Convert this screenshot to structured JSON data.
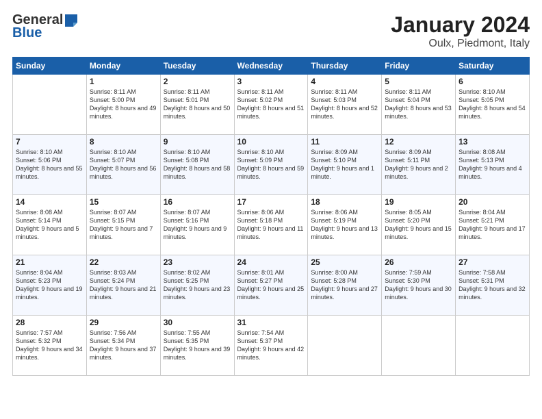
{
  "logo": {
    "general": "General",
    "blue": "Blue"
  },
  "title": "January 2024",
  "subtitle": "Oulx, Piedmont, Italy",
  "days_of_week": [
    "Sunday",
    "Monday",
    "Tuesday",
    "Wednesday",
    "Thursday",
    "Friday",
    "Saturday"
  ],
  "weeks": [
    [
      {
        "day": "",
        "sunrise": "",
        "sunset": "",
        "daylight": "",
        "empty": true
      },
      {
        "day": "1",
        "sunrise": "Sunrise: 8:11 AM",
        "sunset": "Sunset: 5:00 PM",
        "daylight": "Daylight: 8 hours and 49 minutes."
      },
      {
        "day": "2",
        "sunrise": "Sunrise: 8:11 AM",
        "sunset": "Sunset: 5:01 PM",
        "daylight": "Daylight: 8 hours and 50 minutes."
      },
      {
        "day": "3",
        "sunrise": "Sunrise: 8:11 AM",
        "sunset": "Sunset: 5:02 PM",
        "daylight": "Daylight: 8 hours and 51 minutes."
      },
      {
        "day": "4",
        "sunrise": "Sunrise: 8:11 AM",
        "sunset": "Sunset: 5:03 PM",
        "daylight": "Daylight: 8 hours and 52 minutes."
      },
      {
        "day": "5",
        "sunrise": "Sunrise: 8:11 AM",
        "sunset": "Sunset: 5:04 PM",
        "daylight": "Daylight: 8 hours and 53 minutes."
      },
      {
        "day": "6",
        "sunrise": "Sunrise: 8:10 AM",
        "sunset": "Sunset: 5:05 PM",
        "daylight": "Daylight: 8 hours and 54 minutes."
      }
    ],
    [
      {
        "day": "7",
        "sunrise": "Sunrise: 8:10 AM",
        "sunset": "Sunset: 5:06 PM",
        "daylight": "Daylight: 8 hours and 55 minutes."
      },
      {
        "day": "8",
        "sunrise": "Sunrise: 8:10 AM",
        "sunset": "Sunset: 5:07 PM",
        "daylight": "Daylight: 8 hours and 56 minutes."
      },
      {
        "day": "9",
        "sunrise": "Sunrise: 8:10 AM",
        "sunset": "Sunset: 5:08 PM",
        "daylight": "Daylight: 8 hours and 58 minutes."
      },
      {
        "day": "10",
        "sunrise": "Sunrise: 8:10 AM",
        "sunset": "Sunset: 5:09 PM",
        "daylight": "Daylight: 8 hours and 59 minutes."
      },
      {
        "day": "11",
        "sunrise": "Sunrise: 8:09 AM",
        "sunset": "Sunset: 5:10 PM",
        "daylight": "Daylight: 9 hours and 1 minute."
      },
      {
        "day": "12",
        "sunrise": "Sunrise: 8:09 AM",
        "sunset": "Sunset: 5:11 PM",
        "daylight": "Daylight: 9 hours and 2 minutes."
      },
      {
        "day": "13",
        "sunrise": "Sunrise: 8:08 AM",
        "sunset": "Sunset: 5:13 PM",
        "daylight": "Daylight: 9 hours and 4 minutes."
      }
    ],
    [
      {
        "day": "14",
        "sunrise": "Sunrise: 8:08 AM",
        "sunset": "Sunset: 5:14 PM",
        "daylight": "Daylight: 9 hours and 5 minutes."
      },
      {
        "day": "15",
        "sunrise": "Sunrise: 8:07 AM",
        "sunset": "Sunset: 5:15 PM",
        "daylight": "Daylight: 9 hours and 7 minutes."
      },
      {
        "day": "16",
        "sunrise": "Sunrise: 8:07 AM",
        "sunset": "Sunset: 5:16 PM",
        "daylight": "Daylight: 9 hours and 9 minutes."
      },
      {
        "day": "17",
        "sunrise": "Sunrise: 8:06 AM",
        "sunset": "Sunset: 5:18 PM",
        "daylight": "Daylight: 9 hours and 11 minutes."
      },
      {
        "day": "18",
        "sunrise": "Sunrise: 8:06 AM",
        "sunset": "Sunset: 5:19 PM",
        "daylight": "Daylight: 9 hours and 13 minutes."
      },
      {
        "day": "19",
        "sunrise": "Sunrise: 8:05 AM",
        "sunset": "Sunset: 5:20 PM",
        "daylight": "Daylight: 9 hours and 15 minutes."
      },
      {
        "day": "20",
        "sunrise": "Sunrise: 8:04 AM",
        "sunset": "Sunset: 5:21 PM",
        "daylight": "Daylight: 9 hours and 17 minutes."
      }
    ],
    [
      {
        "day": "21",
        "sunrise": "Sunrise: 8:04 AM",
        "sunset": "Sunset: 5:23 PM",
        "daylight": "Daylight: 9 hours and 19 minutes."
      },
      {
        "day": "22",
        "sunrise": "Sunrise: 8:03 AM",
        "sunset": "Sunset: 5:24 PM",
        "daylight": "Daylight: 9 hours and 21 minutes."
      },
      {
        "day": "23",
        "sunrise": "Sunrise: 8:02 AM",
        "sunset": "Sunset: 5:25 PM",
        "daylight": "Daylight: 9 hours and 23 minutes."
      },
      {
        "day": "24",
        "sunrise": "Sunrise: 8:01 AM",
        "sunset": "Sunset: 5:27 PM",
        "daylight": "Daylight: 9 hours and 25 minutes."
      },
      {
        "day": "25",
        "sunrise": "Sunrise: 8:00 AM",
        "sunset": "Sunset: 5:28 PM",
        "daylight": "Daylight: 9 hours and 27 minutes."
      },
      {
        "day": "26",
        "sunrise": "Sunrise: 7:59 AM",
        "sunset": "Sunset: 5:30 PM",
        "daylight": "Daylight: 9 hours and 30 minutes."
      },
      {
        "day": "27",
        "sunrise": "Sunrise: 7:58 AM",
        "sunset": "Sunset: 5:31 PM",
        "daylight": "Daylight: 9 hours and 32 minutes."
      }
    ],
    [
      {
        "day": "28",
        "sunrise": "Sunrise: 7:57 AM",
        "sunset": "Sunset: 5:32 PM",
        "daylight": "Daylight: 9 hours and 34 minutes."
      },
      {
        "day": "29",
        "sunrise": "Sunrise: 7:56 AM",
        "sunset": "Sunset: 5:34 PM",
        "daylight": "Daylight: 9 hours and 37 minutes."
      },
      {
        "day": "30",
        "sunrise": "Sunrise: 7:55 AM",
        "sunset": "Sunset: 5:35 PM",
        "daylight": "Daylight: 9 hours and 39 minutes."
      },
      {
        "day": "31",
        "sunrise": "Sunrise: 7:54 AM",
        "sunset": "Sunset: 5:37 PM",
        "daylight": "Daylight: 9 hours and 42 minutes."
      },
      {
        "day": "",
        "sunrise": "",
        "sunset": "",
        "daylight": "",
        "empty": true
      },
      {
        "day": "",
        "sunrise": "",
        "sunset": "",
        "daylight": "",
        "empty": true
      },
      {
        "day": "",
        "sunrise": "",
        "sunset": "",
        "daylight": "",
        "empty": true
      }
    ]
  ]
}
